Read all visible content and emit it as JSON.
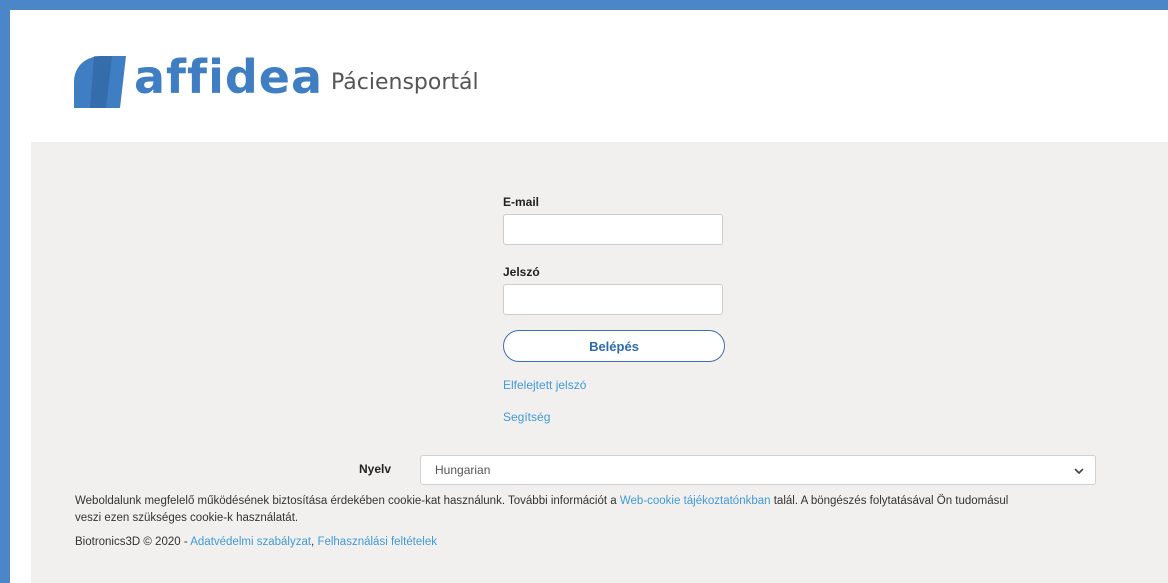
{
  "brand": {
    "logo_text": "affidea",
    "portal_name": "Páciensportál",
    "color": "#3f7ec3"
  },
  "colors": {
    "frame_border": "#4a86c8",
    "panel_bg": "#f2f0ee",
    "link": "#3f9ad8",
    "button_border": "#3d6faa"
  },
  "login": {
    "email_label": "E-mail",
    "email_value": "",
    "password_label": "Jelszó",
    "password_value": "",
    "submit_label": "Belépés",
    "forgot_password_link": "Elfelejtett jelszó",
    "help_link": "Segítség"
  },
  "language": {
    "label": "Nyelv",
    "selected": "Hungarian",
    "icon": "chevron-down-icon"
  },
  "cookie_notice": {
    "text_before": "Weboldalunk megfelelő működésének biztosítása érdekében cookie-kat használunk. További információt a ",
    "link": "Web-cookie tájékoztatónkban",
    "text_after": " talál. A böngészés folytatásával Ön tudomásul veszi ezen szükséges cookie-k használatát."
  },
  "footer": {
    "copyright": "Biotronics3D © 2020 - ",
    "privacy_link": "Adatvédelmi szabályzat",
    "separator": ", ",
    "terms_link": "Felhasználási feltételek"
  }
}
